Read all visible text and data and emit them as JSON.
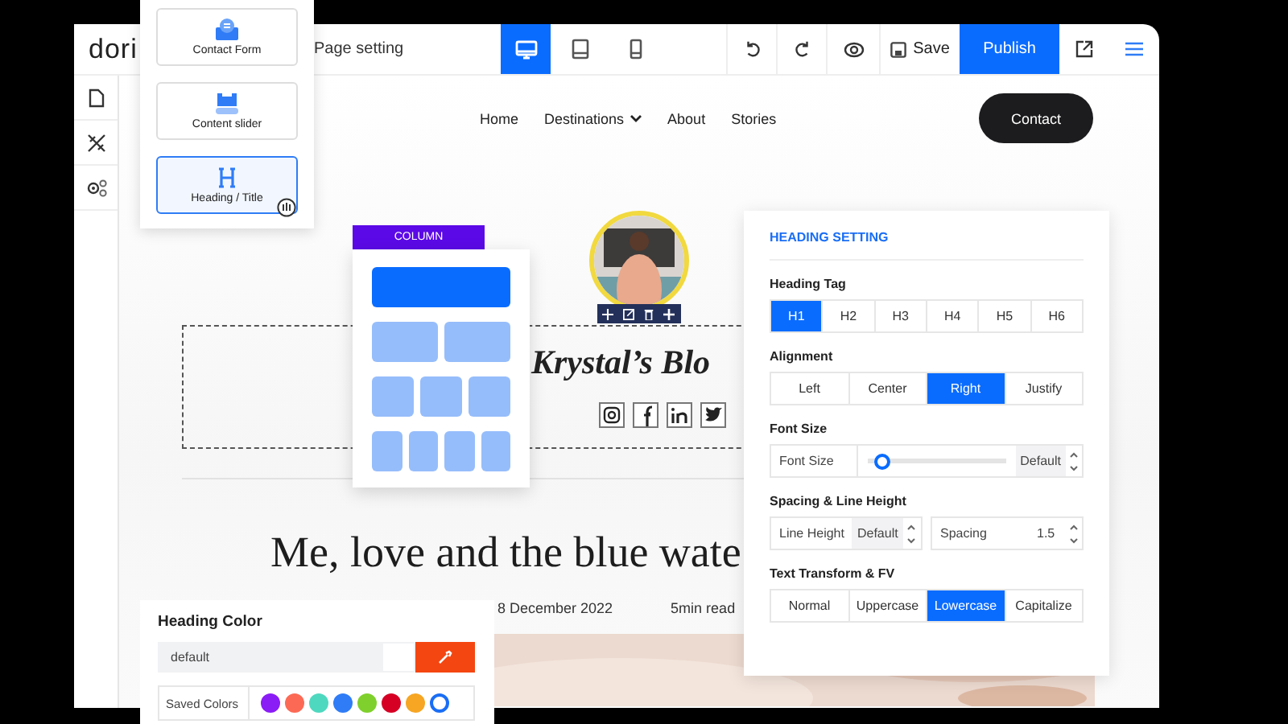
{
  "editor": {
    "logo": "dori",
    "page_setting": "Page setting",
    "devices": [
      {
        "kind": "desktop",
        "selected": true
      },
      {
        "kind": "tablet",
        "selected": false
      },
      {
        "kind": "mobile",
        "selected": false
      }
    ],
    "save": "Save",
    "publish": "Publish"
  },
  "widgets": [
    {
      "kind": "form",
      "label": "Contact Form",
      "selected": false
    },
    {
      "kind": "slider",
      "label": "Content slider",
      "selected": false
    },
    {
      "kind": "heading",
      "label": "Heading / Title",
      "selected": true
    }
  ],
  "site": {
    "nav": [
      {
        "label": "Home",
        "dropdown": false
      },
      {
        "label": "Destinations",
        "dropdown": true
      },
      {
        "label": "About",
        "dropdown": false
      },
      {
        "label": "Stories",
        "dropdown": false
      }
    ],
    "contact": "Contact",
    "blog_title": "Krystal’s Blo",
    "post_title": "Me, love and the blue wate",
    "date": "8 December 2022",
    "read_time": "5min read"
  },
  "column_popover": {
    "title": "COLUMN",
    "layouts": [
      {
        "selected": true
      },
      {
        "selected": false
      },
      {
        "selected": false
      },
      {
        "selected": false
      }
    ]
  },
  "heading_setting": {
    "title": "HEADING SETTING",
    "tag_label": "Heading Tag",
    "tags": [
      {
        "label": "H1",
        "selected": true
      },
      {
        "label": "H2",
        "selected": false
      },
      {
        "label": "H3",
        "selected": false
      },
      {
        "label": "H4",
        "selected": false
      },
      {
        "label": "H5",
        "selected": false
      },
      {
        "label": "H6",
        "selected": false
      }
    ],
    "alignment_label": "Alignment",
    "alignments": [
      {
        "label": "Left",
        "selected": false
      },
      {
        "label": "Center",
        "selected": false
      },
      {
        "label": "Right",
        "selected": true
      },
      {
        "label": "Justify",
        "selected": false
      }
    ],
    "font_size_label": "Font Size",
    "font_size": {
      "label": "Font Size",
      "level": 0.1,
      "value": "Default"
    },
    "spacing_label": "Spacing & Line Height",
    "line_height": {
      "label": "Line Height",
      "value": "Default"
    },
    "spacing": {
      "label": "Spacing",
      "value": "1.5"
    },
    "transform_label": "Text Transform & FV",
    "transforms": [
      {
        "label": "Normal",
        "selected": false
      },
      {
        "label": "Uppercase",
        "selected": false
      },
      {
        "label": "Lowercase",
        "selected": true
      },
      {
        "label": "Capitalize",
        "selected": false
      }
    ]
  },
  "heading_color": {
    "title": "Heading Color",
    "value": "default",
    "saved_label": "Saved Colors",
    "saved_colors": [
      {
        "color": "#8a1cf6",
        "selected": false
      },
      {
        "color": "#fc6a55",
        "selected": false
      },
      {
        "color": "#4fd8c0",
        "selected": false
      },
      {
        "color": "#2f7cf6",
        "selected": false
      },
      {
        "color": "#7fd02c",
        "selected": false
      },
      {
        "color": "#d60024",
        "selected": false
      },
      {
        "color": "#f6a623",
        "selected": false
      },
      {
        "color": "#1a6ef5",
        "selected": true
      }
    ]
  }
}
